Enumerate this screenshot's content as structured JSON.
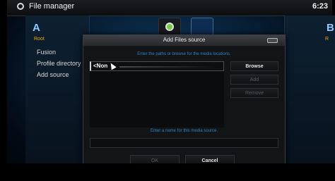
{
  "header": {
    "title": "File manager",
    "clock": "6:23",
    "app_icon": "power-icon"
  },
  "left_panel": {
    "letter": "A",
    "root_label": "Root",
    "items": [
      {
        "label": "Fusion"
      },
      {
        "label": "Profile directory"
      },
      {
        "label": "Add source"
      }
    ]
  },
  "right_panel": {
    "letter": "B",
    "root_label": "R"
  },
  "top_icons": [
    "disc-icon",
    "folder-icon"
  ],
  "dialog": {
    "title": "Add Files source",
    "instruction": "Enter the paths or browse for the media locations.",
    "path_value": "<Non",
    "buttons": {
      "browse": "Browse",
      "add": "Add",
      "remove": "Remove"
    },
    "name_instruction": "Enter a name for this media source.",
    "name_value": "",
    "ok": "OK",
    "cancel": "Cancel"
  },
  "colors": {
    "accent_blue": "#2d86c9",
    "root_orange": "#f3a800",
    "disc_green": "#7ac943"
  }
}
